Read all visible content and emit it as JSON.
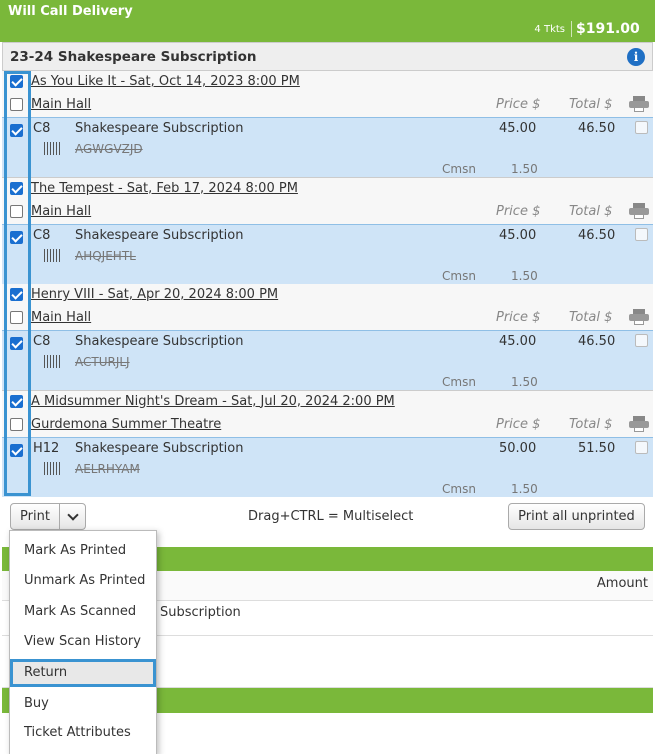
{
  "header": {
    "title": "Will Call Delivery",
    "tickets": "4 Tkts",
    "total": "$191.00"
  },
  "package": {
    "name": "23-24 Shakespeare Subscription",
    "info_icon": "info-icon"
  },
  "columns": {
    "price": "Price $",
    "total": "Total $"
  },
  "events": [
    {
      "title": "As You Like It - Sat, Oct 14, 2023 8:00 PM",
      "venue": "Main Hall",
      "seat": "C8",
      "ticket_name": "Shakespeare Subscription",
      "code": "AGWGVZJD",
      "price": "45.00",
      "total": "46.50",
      "cmsn_label": "Cmsn",
      "cmsn": "1.50"
    },
    {
      "title": "The Tempest - Sat, Feb 17, 2024 8:00 PM",
      "venue": "Main Hall",
      "seat": "C8",
      "ticket_name": "Shakespeare Subscription",
      "code": "AHQJEHTL",
      "price": "45.00",
      "total": "46.50",
      "cmsn_label": "Cmsn",
      "cmsn": "1.50"
    },
    {
      "title": "Henry VIII - Sat, Apr 20, 2024 8:00 PM",
      "venue": "Main Hall",
      "seat": "C8",
      "ticket_name": "Shakespeare Subscription",
      "code": "ACTURJLJ",
      "price": "45.00",
      "total": "46.50",
      "cmsn_label": "Cmsn",
      "cmsn": "1.50"
    },
    {
      "title": "A Midsummer Night's Dream - Sat, Jul 20, 2024 2:00 PM",
      "venue": "Gurdemona Summer Theatre",
      "seat": "H12",
      "ticket_name": "Shakespeare Subscription",
      "code": "AELRHYAM",
      "price": "50.00",
      "total": "51.50",
      "cmsn_label": "Cmsn",
      "cmsn": "1.50"
    }
  ],
  "toolbar": {
    "print_label": "Print",
    "hint": "Drag+CTRL = Multiselect",
    "print_all_label": "Print all unprinted"
  },
  "lower": {
    "amount_label": "Amount",
    "subscription_text": "Subscription"
  },
  "menu": {
    "items": [
      "Mark As Printed",
      "Unmark As Printed",
      "Mark As Scanned",
      "View Scan History",
      "Return",
      "Buy",
      "Ticket Attributes"
    ],
    "highlighted": "Return"
  },
  "colors": {
    "header_green": "#7ab83a",
    "selected_blue": "#cfe4f7",
    "highlight_border": "#3a93d1"
  }
}
